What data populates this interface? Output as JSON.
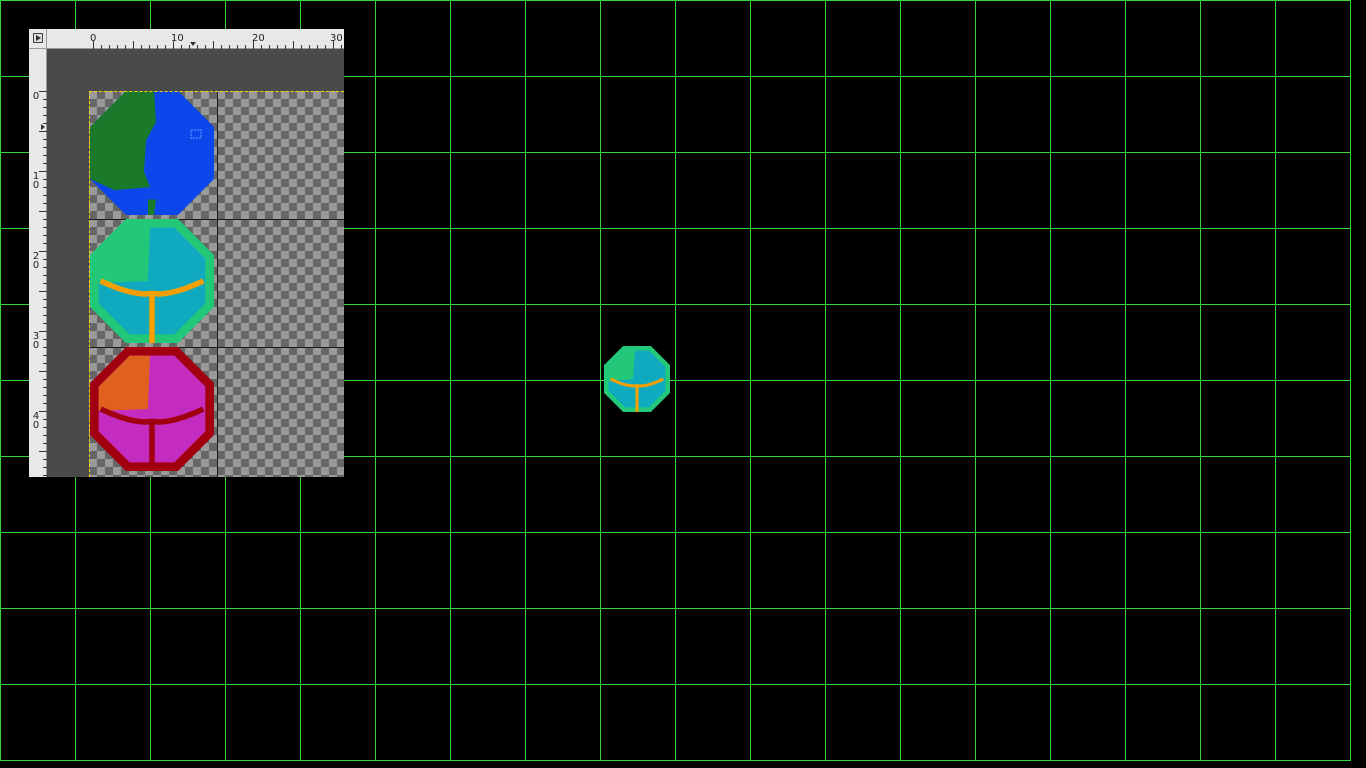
{
  "editor": {
    "h_ruler_labels": [
      "0",
      "10",
      "20",
      "30"
    ],
    "v_ruler_labels": [
      "0",
      "10",
      "20",
      "30",
      "40"
    ],
    "corner_icon": "play-triangle-icon"
  },
  "sprites": [
    {
      "name": "frame-1-planet-blue-green",
      "colors": {
        "primary": "#0b47ea",
        "secondary": "#1b7a2a"
      }
    },
    {
      "name": "frame-2-cyan-orange",
      "colors": {
        "primary": "#10aac0",
        "secondary": "#22c878",
        "trim": "#f5a000"
      }
    },
    {
      "name": "frame-3-magenta-red",
      "colors": {
        "primary": "#c42cc0",
        "secondary": "#e06020",
        "trim": "#a00010"
      }
    }
  ],
  "colors": {
    "grid_line": "#38d838",
    "background": "#000000",
    "editor_bg": "#4a4a4a",
    "selection": "#ffd400"
  }
}
